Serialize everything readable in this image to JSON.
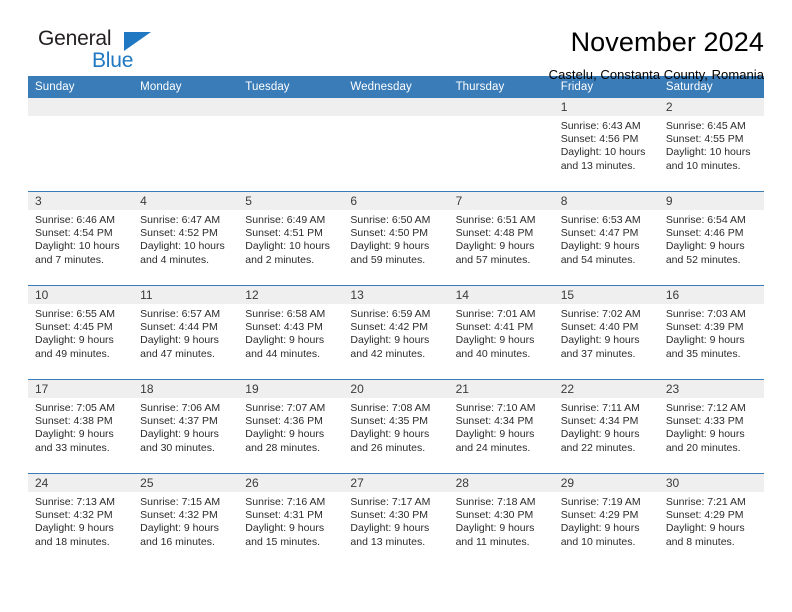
{
  "logo": {
    "word_one": "General",
    "word_two": "Blue",
    "triangle_color": "#1f78c1",
    "icon": "triangle-icon"
  },
  "header": {
    "title": "November 2024",
    "subtitle": "Castelu, Constanta County, Romania"
  },
  "theme": {
    "header_blue": "#3a7cb8",
    "band_gray": "#efefef",
    "text": "#2b2b2b"
  },
  "calendar": {
    "weekday_headers": [
      "Sunday",
      "Monday",
      "Tuesday",
      "Wednesday",
      "Thursday",
      "Friday",
      "Saturday"
    ],
    "weeks": [
      [
        {
          "day": "",
          "empty": true
        },
        {
          "day": "",
          "empty": true
        },
        {
          "day": "",
          "empty": true
        },
        {
          "day": "",
          "empty": true
        },
        {
          "day": "",
          "empty": true
        },
        {
          "day": "1",
          "sunrise": "Sunrise: 6:43 AM",
          "sunset": "Sunset: 4:56 PM",
          "daylight1": "Daylight: 10 hours",
          "daylight2": "and 13 minutes."
        },
        {
          "day": "2",
          "sunrise": "Sunrise: 6:45 AM",
          "sunset": "Sunset: 4:55 PM",
          "daylight1": "Daylight: 10 hours",
          "daylight2": "and 10 minutes."
        }
      ],
      [
        {
          "day": "3",
          "sunrise": "Sunrise: 6:46 AM",
          "sunset": "Sunset: 4:54 PM",
          "daylight1": "Daylight: 10 hours",
          "daylight2": "and 7 minutes."
        },
        {
          "day": "4",
          "sunrise": "Sunrise: 6:47 AM",
          "sunset": "Sunset: 4:52 PM",
          "daylight1": "Daylight: 10 hours",
          "daylight2": "and 4 minutes."
        },
        {
          "day": "5",
          "sunrise": "Sunrise: 6:49 AM",
          "sunset": "Sunset: 4:51 PM",
          "daylight1": "Daylight: 10 hours",
          "daylight2": "and 2 minutes."
        },
        {
          "day": "6",
          "sunrise": "Sunrise: 6:50 AM",
          "sunset": "Sunset: 4:50 PM",
          "daylight1": "Daylight: 9 hours",
          "daylight2": "and 59 minutes."
        },
        {
          "day": "7",
          "sunrise": "Sunrise: 6:51 AM",
          "sunset": "Sunset: 4:48 PM",
          "daylight1": "Daylight: 9 hours",
          "daylight2": "and 57 minutes."
        },
        {
          "day": "8",
          "sunrise": "Sunrise: 6:53 AM",
          "sunset": "Sunset: 4:47 PM",
          "daylight1": "Daylight: 9 hours",
          "daylight2": "and 54 minutes."
        },
        {
          "day": "9",
          "sunrise": "Sunrise: 6:54 AM",
          "sunset": "Sunset: 4:46 PM",
          "daylight1": "Daylight: 9 hours",
          "daylight2": "and 52 minutes."
        }
      ],
      [
        {
          "day": "10",
          "sunrise": "Sunrise: 6:55 AM",
          "sunset": "Sunset: 4:45 PM",
          "daylight1": "Daylight: 9 hours",
          "daylight2": "and 49 minutes."
        },
        {
          "day": "11",
          "sunrise": "Sunrise: 6:57 AM",
          "sunset": "Sunset: 4:44 PM",
          "daylight1": "Daylight: 9 hours",
          "daylight2": "and 47 minutes."
        },
        {
          "day": "12",
          "sunrise": "Sunrise: 6:58 AM",
          "sunset": "Sunset: 4:43 PM",
          "daylight1": "Daylight: 9 hours",
          "daylight2": "and 44 minutes."
        },
        {
          "day": "13",
          "sunrise": "Sunrise: 6:59 AM",
          "sunset": "Sunset: 4:42 PM",
          "daylight1": "Daylight: 9 hours",
          "daylight2": "and 42 minutes."
        },
        {
          "day": "14",
          "sunrise": "Sunrise: 7:01 AM",
          "sunset": "Sunset: 4:41 PM",
          "daylight1": "Daylight: 9 hours",
          "daylight2": "and 40 minutes."
        },
        {
          "day": "15",
          "sunrise": "Sunrise: 7:02 AM",
          "sunset": "Sunset: 4:40 PM",
          "daylight1": "Daylight: 9 hours",
          "daylight2": "and 37 minutes."
        },
        {
          "day": "16",
          "sunrise": "Sunrise: 7:03 AM",
          "sunset": "Sunset: 4:39 PM",
          "daylight1": "Daylight: 9 hours",
          "daylight2": "and 35 minutes."
        }
      ],
      [
        {
          "day": "17",
          "sunrise": "Sunrise: 7:05 AM",
          "sunset": "Sunset: 4:38 PM",
          "daylight1": "Daylight: 9 hours",
          "daylight2": "and 33 minutes."
        },
        {
          "day": "18",
          "sunrise": "Sunrise: 7:06 AM",
          "sunset": "Sunset: 4:37 PM",
          "daylight1": "Daylight: 9 hours",
          "daylight2": "and 30 minutes."
        },
        {
          "day": "19",
          "sunrise": "Sunrise: 7:07 AM",
          "sunset": "Sunset: 4:36 PM",
          "daylight1": "Daylight: 9 hours",
          "daylight2": "and 28 minutes."
        },
        {
          "day": "20",
          "sunrise": "Sunrise: 7:08 AM",
          "sunset": "Sunset: 4:35 PM",
          "daylight1": "Daylight: 9 hours",
          "daylight2": "and 26 minutes."
        },
        {
          "day": "21",
          "sunrise": "Sunrise: 7:10 AM",
          "sunset": "Sunset: 4:34 PM",
          "daylight1": "Daylight: 9 hours",
          "daylight2": "and 24 minutes."
        },
        {
          "day": "22",
          "sunrise": "Sunrise: 7:11 AM",
          "sunset": "Sunset: 4:34 PM",
          "daylight1": "Daylight: 9 hours",
          "daylight2": "and 22 minutes."
        },
        {
          "day": "23",
          "sunrise": "Sunrise: 7:12 AM",
          "sunset": "Sunset: 4:33 PM",
          "daylight1": "Daylight: 9 hours",
          "daylight2": "and 20 minutes."
        }
      ],
      [
        {
          "day": "24",
          "sunrise": "Sunrise: 7:13 AM",
          "sunset": "Sunset: 4:32 PM",
          "daylight1": "Daylight: 9 hours",
          "daylight2": "and 18 minutes."
        },
        {
          "day": "25",
          "sunrise": "Sunrise: 7:15 AM",
          "sunset": "Sunset: 4:32 PM",
          "daylight1": "Daylight: 9 hours",
          "daylight2": "and 16 minutes."
        },
        {
          "day": "26",
          "sunrise": "Sunrise: 7:16 AM",
          "sunset": "Sunset: 4:31 PM",
          "daylight1": "Daylight: 9 hours",
          "daylight2": "and 15 minutes."
        },
        {
          "day": "27",
          "sunrise": "Sunrise: 7:17 AM",
          "sunset": "Sunset: 4:30 PM",
          "daylight1": "Daylight: 9 hours",
          "daylight2": "and 13 minutes."
        },
        {
          "day": "28",
          "sunrise": "Sunrise: 7:18 AM",
          "sunset": "Sunset: 4:30 PM",
          "daylight1": "Daylight: 9 hours",
          "daylight2": "and 11 minutes."
        },
        {
          "day": "29",
          "sunrise": "Sunrise: 7:19 AM",
          "sunset": "Sunset: 4:29 PM",
          "daylight1": "Daylight: 9 hours",
          "daylight2": "and 10 minutes."
        },
        {
          "day": "30",
          "sunrise": "Sunrise: 7:21 AM",
          "sunset": "Sunset: 4:29 PM",
          "daylight1": "Daylight: 9 hours",
          "daylight2": "and 8 minutes."
        }
      ]
    ]
  }
}
